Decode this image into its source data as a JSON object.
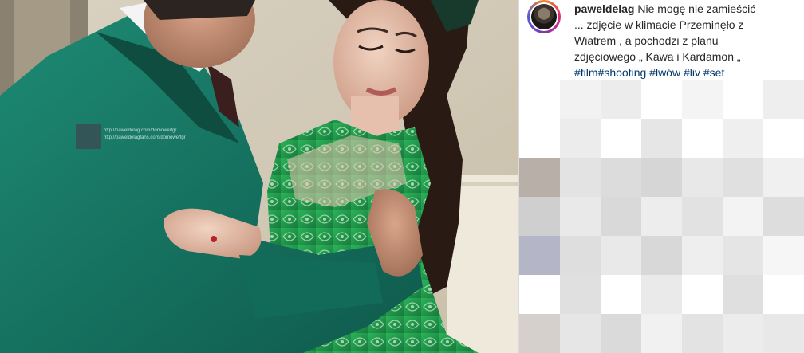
{
  "post": {
    "username": "paweldelag",
    "caption_lines": [
      "Nie mogę nie zamieścić",
      "... zdjęcie w klimacie Przeminęło z",
      "Wiatrem , a pochodzi z planu",
      "zdjęciowego „ Kawa i Kardamon „"
    ],
    "hashtags": [
      "#film",
      "#shooting",
      "#lwów",
      "#liv",
      "#set"
    ]
  },
  "photo": {
    "watermark_lines": [
      "http://paweldelag.com/domowe/fgr",
      "http://paweldelagfans.com/domowe/fgr"
    ]
  },
  "colors": {
    "suit_green": "#14705f",
    "dress_green": "#1f9a4a",
    "hashtag_blue": "#00376b",
    "text_dark": "#262626"
  },
  "icons": {
    "avatar": "profile-avatar-icon"
  }
}
